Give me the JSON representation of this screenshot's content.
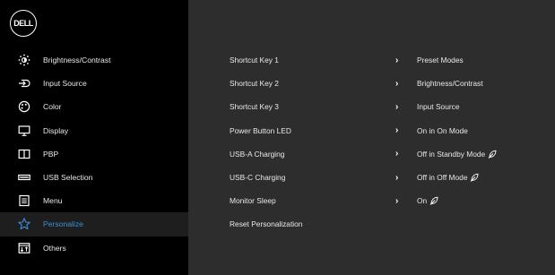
{
  "brand": {
    "logo_text": "DELL"
  },
  "sidebar": {
    "items": [
      {
        "label": "Brightness/Contrast",
        "icon": "sun-icon"
      },
      {
        "label": "Input Source",
        "icon": "input-source-icon"
      },
      {
        "label": "Color",
        "icon": "color-icon"
      },
      {
        "label": "Display",
        "icon": "display-icon"
      },
      {
        "label": "PBP",
        "icon": "pbp-icon"
      },
      {
        "label": "USB Selection",
        "icon": "usb-icon"
      },
      {
        "label": "Menu",
        "icon": "menu-icon"
      },
      {
        "label": "Personalize",
        "icon": "star-icon",
        "selected": true
      },
      {
        "label": "Others",
        "icon": "others-icon"
      }
    ]
  },
  "personalize": {
    "rows": [
      {
        "label": "Shortcut Key 1",
        "value": "Preset Modes",
        "eco": false
      },
      {
        "label": "Shortcut Key 2",
        "value": "Brightness/Contrast",
        "eco": false
      },
      {
        "label": "Shortcut Key 3",
        "value": "Input Source",
        "eco": false
      },
      {
        "label": "Power Button LED",
        "value": "On in On Mode",
        "eco": false
      },
      {
        "label": "USB-A Charging",
        "value": "Off in Standby Mode",
        "eco": true
      },
      {
        "label": "USB-C Charging",
        "value": "Off in Off Mode",
        "eco": true
      },
      {
        "label": "Monitor Sleep",
        "value": "On",
        "eco": true
      },
      {
        "label": "Reset Personalization",
        "value": "",
        "eco": false
      }
    ]
  },
  "colors": {
    "sidebar_bg": "#000000",
    "panel_bg": "#2d2d2d",
    "selected_text": "#3b90d8",
    "selected_bg": "#1e1e1e",
    "text": "#e8e8e8"
  }
}
